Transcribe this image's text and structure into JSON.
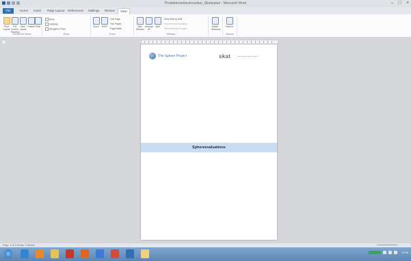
{
  "window": {
    "title": "Produktinnerbeskrivelser_Skatteplan - Microsoft Word"
  },
  "ribbon_tabs": [
    "File",
    "Home",
    "Insert",
    "Page Layout",
    "References",
    "Mailings",
    "Review",
    "View"
  ],
  "ribbon_groups": [
    {
      "label": "Document Views",
      "buttons": [
        "Print Layout",
        "Full Screen Reading",
        "Web Layout",
        "Outline",
        "Draft"
      ]
    },
    {
      "label": "Show",
      "checks": [
        "Ruler",
        "Gridlines",
        "Navigation Pane"
      ]
    },
    {
      "label": "Zoom",
      "buttons": [
        "Zoom",
        "100%"
      ],
      "checks": [
        "One Page",
        "Two Pages",
        "Page Width"
      ]
    },
    {
      "label": "Window",
      "buttons": [
        "New Window",
        "Arrange All",
        "Split"
      ],
      "checks": [
        "View Side by Side",
        "Synchronous Scrolling",
        "Reset Window Position"
      ]
    },
    {
      "label": "",
      "buttons": [
        "Switch Windows"
      ]
    },
    {
      "label": "Macros",
      "buttons": [
        "Macros"
      ]
    }
  ],
  "document": {
    "logo_text": "The Sphere Project",
    "partner_logo": "skat",
    "heading": "Sphereevaluations"
  },
  "status": {
    "left": "Page: 1 of 1   Words: 3   Danish"
  },
  "colors": {
    "file_tab": "#2f6fb3",
    "band": "#c9dcf2",
    "taskbar": "#6b93c0"
  },
  "taskbar_icons": [
    "start-orb",
    "explorer",
    "firefox",
    "folder",
    "word",
    "media-player",
    "chrome",
    "outlook",
    "paint",
    "notes"
  ],
  "tray": {
    "clock": "12:00"
  }
}
